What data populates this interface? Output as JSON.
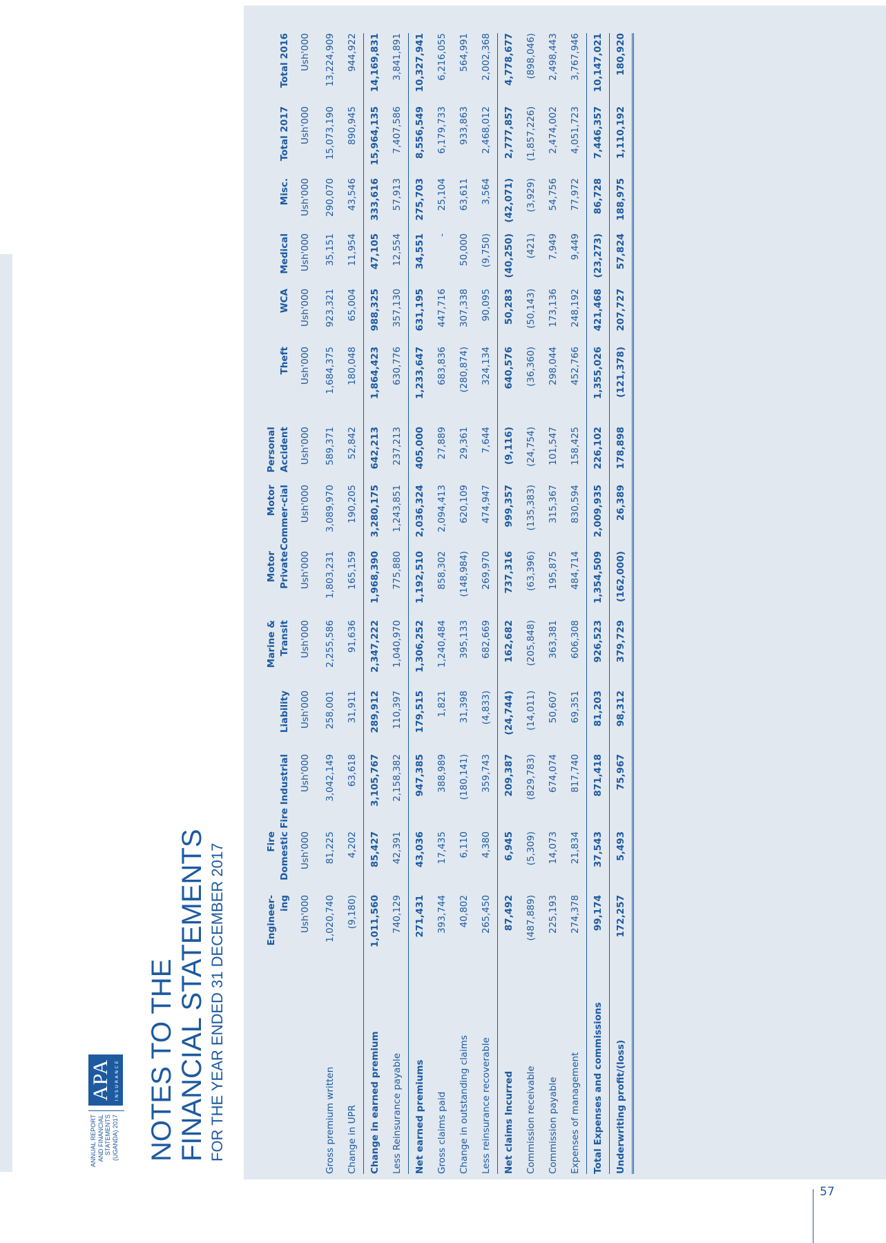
{
  "header": {
    "report_lines": [
      "ANNUAL REPORT",
      "AND FINANCIAL",
      "STATEMENTS",
      "(UGANDA) 2017"
    ],
    "logo_text": "APA",
    "logo_sub": "INSURANCE",
    "title_line1": "NOTES TO THE",
    "title_line2": "FINANCIAL STATEMENTS",
    "subtitle": "FOR THE YEAR ENDED 31 DECEMBER 2017"
  },
  "page_number": "57",
  "table": {
    "columns": [
      "Engineer-ing",
      "Fire Domestic",
      "Fire Industrial",
      "Liability",
      "Marine & Transit",
      "Motor Private",
      "Motor Commer-cial",
      "Personal Accident",
      "Theft",
      "WCA",
      "Medical",
      "Misc.",
      "Total 2017",
      "Total 2016"
    ],
    "units": [
      "Ush'000",
      "Ush'000",
      "Ush'000",
      "Ush'000",
      "Ush'000",
      "Ush'000",
      "Ush'000",
      "Ush'000",
      "Ush'000",
      "Ush'000",
      "Ush'000",
      "Ush'000",
      "Ush'000",
      "Ush'000"
    ],
    "rows": [
      {
        "label": "Gross premium  written",
        "values": [
          "1,020,740",
          "81,225",
          "3,042,149",
          "258,001",
          "2,255,586",
          "1,803,231",
          "3,089,970",
          "589,371",
          "1,684,375",
          "923,321",
          "35,151",
          "290,070",
          "15,073,190",
          "13,224,909"
        ]
      },
      {
        "label": "Change in UPR",
        "values": [
          "(9,180)",
          "4,202",
          "63,618",
          "31,911",
          "91,636",
          "165,159",
          "190,205",
          "52,842",
          "180,048",
          "65,004",
          "11,954",
          "43,546",
          "890,945",
          "944,922"
        ]
      },
      {
        "label": "Change in earned premium",
        "values": [
          "1,011,560",
          "85,427",
          "3,105,767",
          "289,912",
          "2,347,222",
          "1,968,390",
          "3,280,175",
          "642,213",
          "1,864,423",
          "988,325",
          "47,105",
          "333,616",
          "15,964,135",
          "14,169,831"
        ]
      },
      {
        "label": "Less Reinsurance payable",
        "values": [
          "740,129",
          "42,391",
          "2,158,382",
          "110,397",
          "1,040,970",
          "775,880",
          "1,243,851",
          "237,213",
          "630,776",
          "357,130",
          "12,554",
          "57,913",
          "7,407,586",
          "3,841,891"
        ]
      },
      {
        "label": "Net earned premiums",
        "values": [
          "271,431",
          "43,036",
          "947,385",
          "179,515",
          "1,306,252",
          "1,192,510",
          "2,036,324",
          "405,000",
          "1,233,647",
          "631,195",
          "34,551",
          "275,703",
          "8,556,549",
          "10,327,941"
        ]
      },
      {
        "label": "Gross claims paid",
        "values": [
          "393,744",
          "17,435",
          "388,989",
          "1,821",
          "1,240,484",
          "858,302",
          "2,094,413",
          "27,889",
          "683,836",
          "447,716",
          "-",
          "25,104",
          "6,179,733",
          "6,216,055"
        ]
      },
      {
        "label": "Change in outstanding claims",
        "values": [
          "40,802",
          "6,110",
          "(180,141)",
          "31,398",
          "395,133",
          "(148,984)",
          "620,109",
          "29,361",
          "(280,874)",
          "307,338",
          "50,000",
          "63,611",
          "933,863",
          "564,991"
        ]
      },
      {
        "label": "Less reinsurance recoverable",
        "values": [
          "265,450",
          "4,380",
          "359,743",
          "(4,833)",
          "682,669",
          "269,970",
          "474,947",
          "7,644",
          "324,134",
          "90,095",
          "(9,750)",
          "3,564",
          "2,468,012",
          "2,002,368"
        ]
      },
      {
        "label": "Net claims Incurred",
        "values": [
          "87,492",
          "6,945",
          "209,387",
          "(24,744)",
          "162,682",
          "737,316",
          "999,357",
          "(9,116)",
          "640,576",
          "50,283",
          "(40,250)",
          "(42,071)",
          "2,777,857",
          "4,778,677"
        ]
      },
      {
        "label": "Commission receivable",
        "values": [
          "(487,889)",
          "(5,309)",
          "(829,783)",
          "(14,011)",
          "(205,848)",
          "(63,396)",
          "(135,383)",
          "(24,754)",
          "(36,360)",
          "(50,143)",
          "(421)",
          "(3,929)",
          "(1,857,226)",
          "(898,046)"
        ]
      },
      {
        "label": "Commission payable",
        "values": [
          "225,193",
          "14,073",
          "674,074",
          "50,607",
          "363,381",
          "195,875",
          "315,367",
          "101,547",
          "298,044",
          "173,136",
          "7,949",
          "54,756",
          "2,474,002",
          "2,498,443"
        ]
      },
      {
        "label": "Expenses of management",
        "values": [
          "274,378",
          "21,834",
          "817,740",
          "69,351",
          "606,308",
          "484,714",
          "830,594",
          "158,425",
          "452,766",
          "248,192",
          "9,449",
          "77,972",
          "4,051,723",
          "3,767,946"
        ]
      },
      {
        "label": "Total Expenses and commissions",
        "values": [
          "99,174",
          "37,543",
          "871,418",
          "81,203",
          "926,523",
          "1,354,509",
          "2,009,935",
          "226,102",
          "1,355,026",
          "421,468",
          "(23,273)",
          "86,728",
          "7,446,357",
          "10,147,021"
        ]
      },
      {
        "label": "Underwriting profit/(loss)",
        "values": [
          "172,257",
          "5,493",
          "75,967",
          "98,312",
          "379,729",
          "(162,000)",
          "26,389",
          "178,898",
          "(121,378)",
          "207,727",
          "57,824",
          "188,975",
          "1,110,192",
          "180,920"
        ]
      }
    ]
  }
}
